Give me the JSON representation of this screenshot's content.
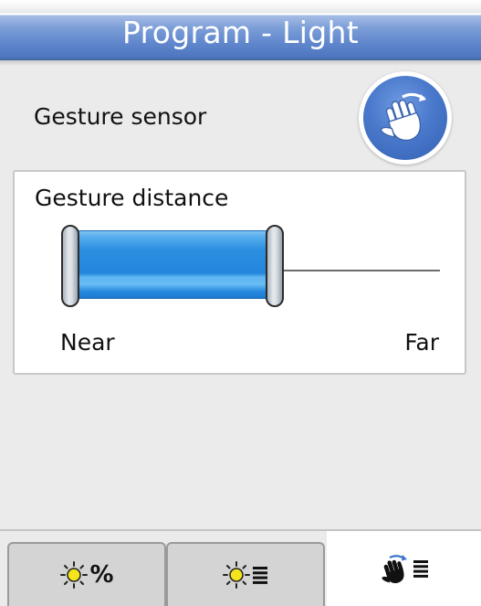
{
  "header": {
    "title": "Program - Light"
  },
  "sensor": {
    "label": "Gesture sensor",
    "button_icon": "hand-wave-icon"
  },
  "distance": {
    "title": "Gesture distance",
    "near_label": "Near",
    "far_label": "Far",
    "range_start": 0.0,
    "range_end": 0.5
  },
  "tabs": [
    {
      "icon": "sun-percent-icon",
      "text": "%",
      "active": false
    },
    {
      "icon": "sun-list-icon",
      "active": false
    },
    {
      "icon": "gesture-list-icon",
      "active": true
    }
  ],
  "colors": {
    "header_blue": "#4e77c0",
    "slider_fill": "#2486dc",
    "sun_yellow": "#f4e41c"
  }
}
